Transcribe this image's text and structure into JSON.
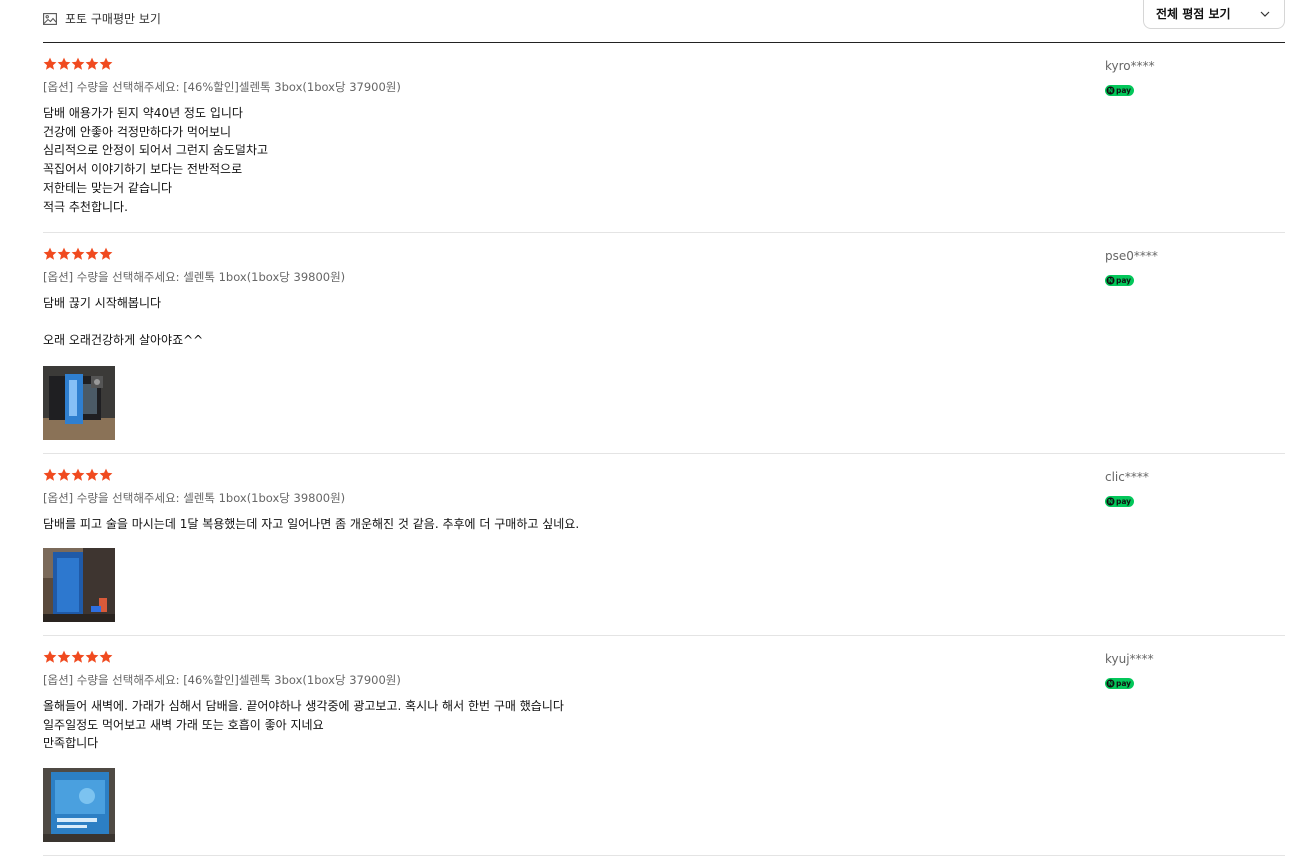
{
  "filter": {
    "photo_label": "포토 구매평만 보기",
    "sort_label": "전체 평점 보기"
  },
  "colors": {
    "star": "#f04a1f",
    "npay": "#03c75a",
    "divider": "#e4e4e4"
  },
  "badge_text": "pay",
  "reviews": [
    {
      "rating": 5,
      "option": "[옵션] 수량을 선택해주세요: [46%할인]셀렌톡 3box(1box당 37900원)",
      "text": "담배 애용가가 된지 약40년 정도 입니다\n건강에 안좋아 걱정만하다가 먹어보니\n심리적으로 안정이 되어서 그런지 숨도덜차고\n꼭집어서 이야기하기 보다는 전반적으로\n저한테는 맞는거 같습니다\n적극 추천합니다.",
      "user": "kyro****"
    },
    {
      "rating": 5,
      "option": "[옵션] 수량을 선택해주세요: 셀렌톡 1box(1box당 39800원)",
      "text": "담배 끊기 시작해봅니다\n\n오래 오래건강하게 살아야죠^^",
      "user": "pse0****",
      "has_photo": true
    },
    {
      "rating": 5,
      "option": "[옵션] 수량을 선택해주세요: 셀렌톡 1box(1box당 39800원)",
      "text": "담배를 피고 술을 마시는데 1달 복용했는데 자고 일어나면 좀 개운해진 것 같음. 추후에 더 구매하고 싶네요.",
      "user": "clic****",
      "has_photo": true
    },
    {
      "rating": 5,
      "option": "[옵션] 수량을 선택해주세요: [46%할인]셀렌톡 3box(1box당 37900원)",
      "text": "올해들어 새벽에. 가래가 심해서 담배을. 끝어야하나 생각중에 광고보고. 혹시나 해서 한번 구매 했습니다\n일주일정도 먹어보고 새벽 가래 또는 호흡이 좋아 지네요\n만족합니다",
      "user": "kyuj****",
      "has_photo": true
    }
  ]
}
